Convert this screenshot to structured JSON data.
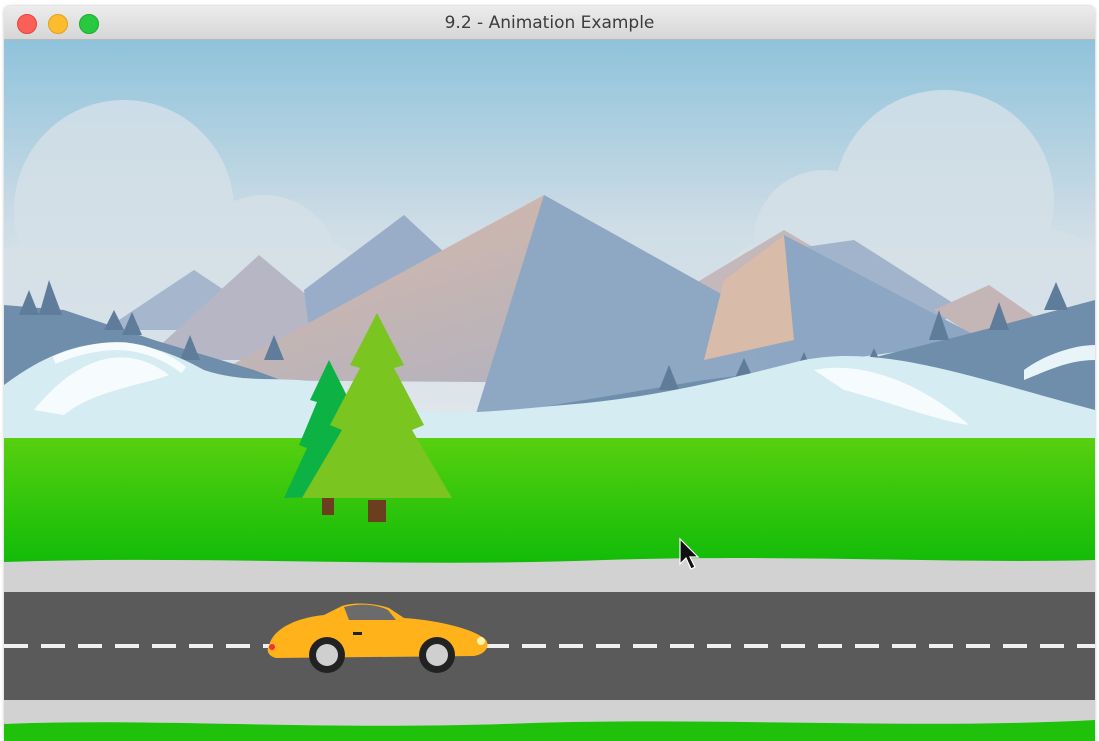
{
  "window": {
    "title": "9.2 - Animation Example",
    "controls": [
      "close",
      "minimize",
      "zoom"
    ]
  },
  "scene": {
    "description_elements": [
      "sky",
      "clouds",
      "mountains",
      "snowy-hills",
      "grass",
      "trees",
      "road",
      "car",
      "mouse-cursor"
    ],
    "colors": {
      "sky_top": "#8fc3db",
      "sky_bottom": "#dfe6ea",
      "mountain": "#8ea8c4",
      "snow": "#d4ecf2",
      "grass": "#1fc10a",
      "road": "#5a5a5a",
      "curb": "#d2d2d2",
      "car_body": "#ffb21a",
      "tree_dark": "#0db244",
      "tree_light": "#7bc520"
    }
  }
}
